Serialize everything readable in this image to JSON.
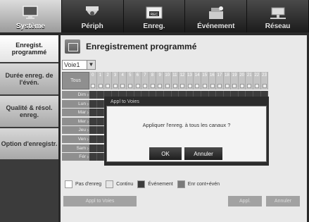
{
  "top_menu": [
    {
      "label": "Système",
      "icon": "monitor-icon"
    },
    {
      "label": "Périph",
      "icon": "camera-icon"
    },
    {
      "label": "Enreg.",
      "icon": "rec-icon"
    },
    {
      "label": "Événement",
      "icon": "event-icon"
    },
    {
      "label": "Réseau",
      "icon": "network-icon"
    }
  ],
  "left_menu": [
    {
      "label": "Enregist. programmé"
    },
    {
      "label": "Durée enreg. de l'évén."
    },
    {
      "label": "Qualité & résol. enreg."
    },
    {
      "label": "Option d'enregistr."
    }
  ],
  "page": {
    "title": "Enregistrement programmé",
    "channel_select": "Voie1",
    "all_label": "Tous"
  },
  "hours": [
    "0",
    "1",
    "2",
    "3",
    "4",
    "5",
    "6",
    "7",
    "8",
    "9",
    "10",
    "11",
    "12",
    "13",
    "14",
    "15",
    "16",
    "17",
    "18",
    "19",
    "20",
    "21",
    "22",
    "23"
  ],
  "days": [
    "Dim",
    "Lun",
    "Mar",
    "Mer",
    "Jeu",
    "Ven",
    "Sam",
    "Fér"
  ],
  "legend": [
    {
      "label": "Pas d'enreg",
      "color": "#ffffff"
    },
    {
      "label": "Continu",
      "color": "#e6e6e6"
    },
    {
      "label": "Événement",
      "color": "#3c3c3c"
    },
    {
      "label": "Enr cont+évén",
      "color": "#7a7a7a"
    }
  ],
  "buttons": {
    "apply_channels": "Appl to Voies",
    "apply": "Appl.",
    "cancel": "Annuler"
  },
  "dialog": {
    "title": "Appl to Voies",
    "message": "Appliquer l'enreg. à tous les canaux ?",
    "ok": "OK",
    "cancel": "Annuler"
  },
  "colors": {
    "event_cell": "#3c3c3c",
    "dialog_bg": "#f3f3f3"
  }
}
